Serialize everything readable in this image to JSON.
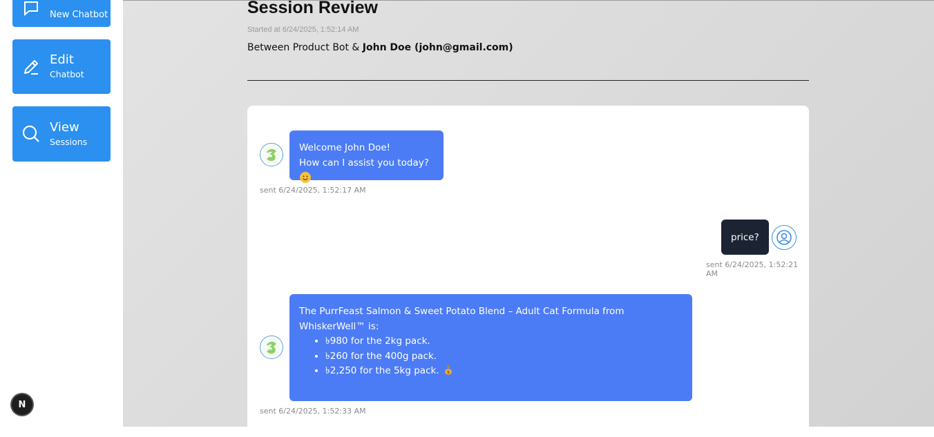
{
  "sidebar": {
    "new_chatbot": {
      "title": "",
      "subtitle": "New Chatbot",
      "icon": "chat-bubble-icon"
    },
    "edit_chatbot": {
      "title": "Edit",
      "subtitle": "Chatbot",
      "icon": "pencil-icon"
    },
    "view_sessions": {
      "title": "View",
      "subtitle": "Sessions",
      "icon": "search-icon"
    },
    "dev_badge": "N"
  },
  "session": {
    "title": "Session Review",
    "started": "Started at 6/24/2025, 1:52:14 AM",
    "between_prefix": "Between Product Bot & ",
    "between_user": "John Doe (john@gmail.com)"
  },
  "messages": {
    "m1": {
      "line1": "Welcome John Doe!",
      "line2": "How can I assist you today?",
      "sent": "sent 6/24/2025, 1:52:17 AM"
    },
    "m2": {
      "text": "price?",
      "sent": "sent 6/24/2025, 1:52:21 AM"
    },
    "m3": {
      "intro": "The PurrFeast Salmon & Sweet Potato Blend – Adult Cat Formula from WhiskerWell™ is:",
      "items": [
        "৳980 for the 2kg pack.",
        "৳260 for the 400g pack.",
        "৳2,250 for the 5kg pack."
      ],
      "sent": "sent 6/24/2025, 1:52:33 AM"
    }
  },
  "colors": {
    "primary": "#2b90f0",
    "bot_bubble": "#4c7cf5",
    "user_bubble": "#1c2333"
  }
}
